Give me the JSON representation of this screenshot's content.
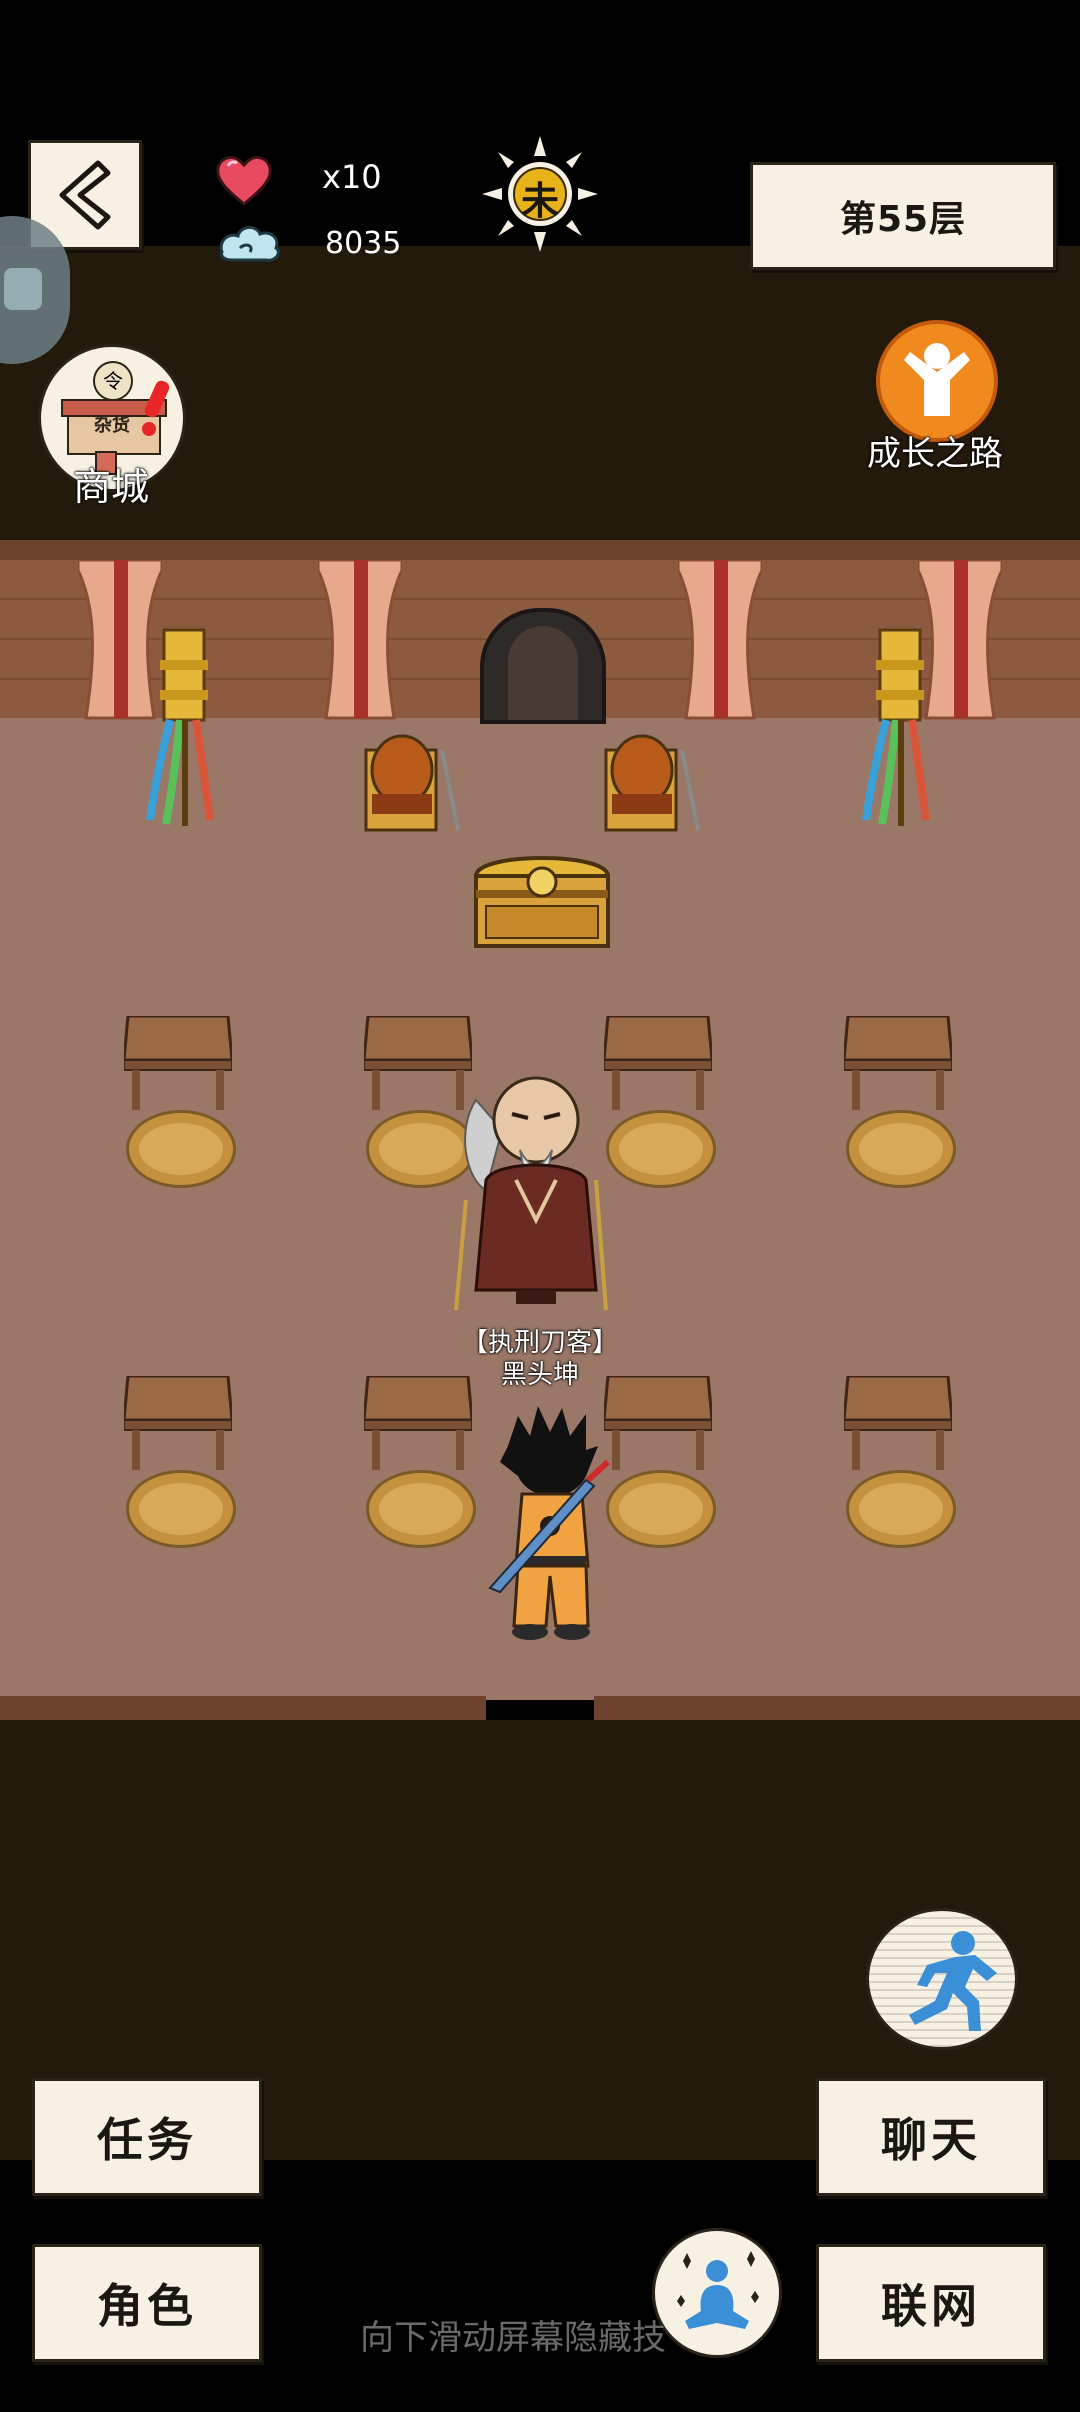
{
  "hud": {
    "lives_text": "x10",
    "spirit_value": "8035",
    "time_glyph": "未",
    "floor_label": "第55层"
  },
  "shop": {
    "sign_text": "杂货",
    "coin_glyph": "令",
    "label": "商城"
  },
  "growth": {
    "label": "成长之路"
  },
  "npc": {
    "title": "【执刑刀客】",
    "name": "黑头坤"
  },
  "menu": {
    "task_label": "任务",
    "role_label": "角色",
    "chat_label": "聊天",
    "network_label": "联网"
  },
  "hint": {
    "text": "向下滑动屏幕隐藏技"
  },
  "colors": {
    "background": "#000000",
    "hud_band": "#231a0c",
    "wall": "#8b5a3f",
    "floor": "#9a7766",
    "paper": "#f6f1e3",
    "heart": "#e84a5f",
    "run_icon": "#3b8fd6"
  }
}
